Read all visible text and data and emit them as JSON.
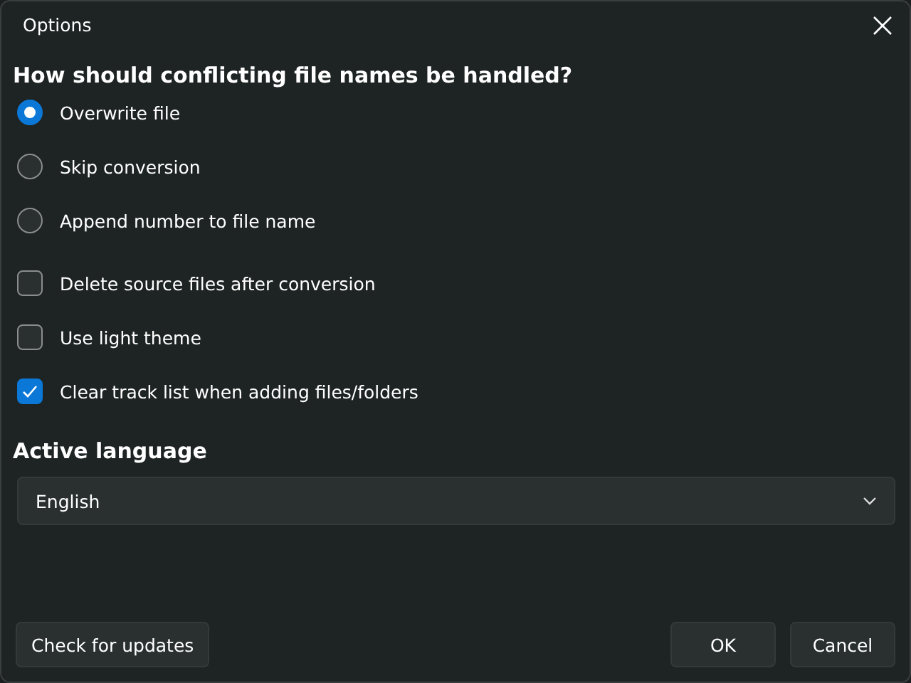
{
  "window": {
    "title": "Options"
  },
  "conflict": {
    "heading": "How should conflicting file names be handled?",
    "options": [
      {
        "label": "Overwrite file",
        "selected": true
      },
      {
        "label": "Skip conversion",
        "selected": false
      },
      {
        "label": "Append number to file name",
        "selected": false
      }
    ]
  },
  "settings": [
    {
      "label": "Delete source files after conversion",
      "checked": false
    },
    {
      "label": "Use light theme",
      "checked": false
    },
    {
      "label": "Clear track list when adding files/folders",
      "checked": true
    }
  ],
  "language": {
    "heading": "Active language",
    "value": "English"
  },
  "buttons": {
    "left": "Check for updates",
    "ok": "OK",
    "cancel": "Cancel"
  }
}
